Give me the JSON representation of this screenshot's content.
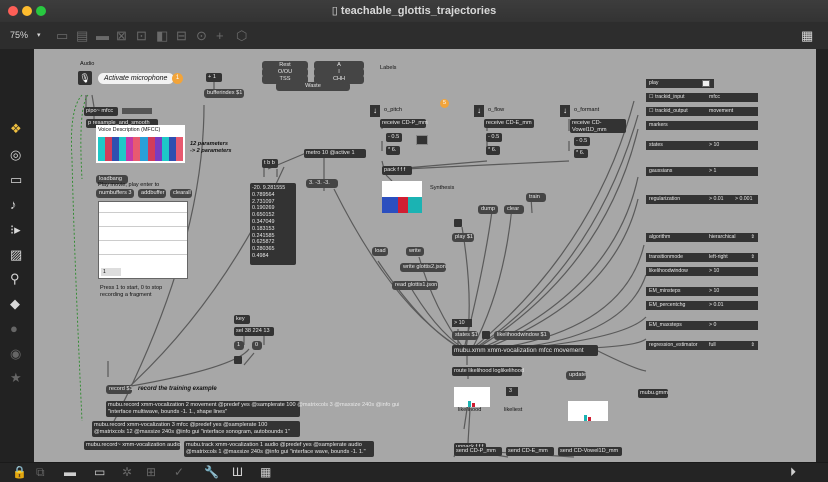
{
  "window": {
    "title": "teachable_glottis_trajectories",
    "zoom": "75%"
  },
  "toolbar": {
    "icons": [
      "presentation-icon",
      "comment-icon",
      "message-icon",
      "button-icon",
      "toggle-icon",
      "slider-icon",
      "dial-icon",
      "new-object-icon",
      "patch-cord-icon"
    ],
    "right_icon": "grid-icon"
  },
  "leftbar": {
    "icons": [
      "objects-icon",
      "target-icon",
      "screen-icon",
      "music-note-icon",
      "jitter-icon",
      "image-icon",
      "link-icon",
      "plugin-icon",
      "circle-icon",
      "sync-icon",
      "star-icon"
    ]
  },
  "bottombar": {
    "icons": [
      "lock-icon",
      "edit-icon",
      "presentation-icon",
      "window-icon",
      "debug-icon",
      "grid-icon",
      "check-icon",
      "wrench-icon",
      "vertical-bars-icon",
      "keyboard-icon",
      "play-icon"
    ]
  },
  "patch": {
    "audio_label": "Audio",
    "mic_label": "Activate microphone",
    "badge_1": "1",
    "pipo_mfcc": "pipo~ mfcc",
    "resample": "p resample_and_smooth",
    "voice_label": "Voice Description (MFCC)",
    "params_note_1": "12 parameters",
    "params_note_2": "-> 2 parameters",
    "loadbang": "loadbang",
    "play_hint": "Play movie, play enter to",
    "numbuffers": "numbuffers 3",
    "addbuffer": "addbuffer",
    "clearall": "clearall",
    "buffer_sel": "1",
    "press_hint_1": "Press 1 to start, 0 to stop",
    "press_hint_2": "recording a fragment",
    "plus1": "+ 1",
    "bufferindex": "bufferindex $1",
    "labels_title": "Labels",
    "labels": [
      "Rest",
      "A",
      "O/OU",
      "I",
      "TSS",
      "CHH",
      "Waste"
    ],
    "tbb": "t b b",
    "metro": "metro 10 @active 1",
    "values_list": [
      "-20. 9.281555",
      "0.789564",
      "2.731097",
      "0.190269",
      "0.650152",
      "0.347049",
      "0.183153",
      "0.241585",
      "0.625872",
      "0.280365",
      "0.4984"
    ],
    "msg_neg3": "3. -3. -3.",
    "key": "key",
    "sel": "sel 38 224 13",
    "num_1": "1",
    "num_0": "0",
    "record": "record $1",
    "record_comment": "record the training example",
    "mubu_record_1": "mubu.record xmm-vocalization 2 movement @predef yes @samplerate 100 @matrixcols 3 @maxsize 240s @info gui",
    "mubu_record_1b": "\"interface multiwave, bounds -1. 1., shape lines\"",
    "mubu_record_2": "mubu.record xmm-vocalization 3 mfcc @predef yes @samplerate 100",
    "mubu_record_2b": "@matrixcols 12 @maxsize 240s @info gui \"interface sonogram, autobounds 1\"",
    "mubu_record_3": "mubu.record~ xmm-vocalization audio",
    "mubu_track": "mubu.track xmm-vocalization 1 audio @predef yes @samplerate audio",
    "mubu_track_b": "@matrixcols 1 @maxsize 240s @info gui \"interface wave, bounds -1. 1.\"",
    "o_pitch": "o_pitch",
    "o_flow": "o_flow",
    "o_formant": "o_formant",
    "receive_p": "receive CD-P_mm",
    "receive_e": "receive CD-E_mm",
    "receive_v": "receive CD-Vowel1D_mm",
    "minus05": "- 0.5",
    "times6": "* 6.",
    "pack": "pack f f f",
    "synthesis": "Synthesis",
    "badge_5": "5",
    "dump": "dump",
    "clear": "clear",
    "train": "train",
    "play_msg": "play $1",
    "load": "load",
    "write": "write",
    "write_file": "write glottis2.json",
    "read_file": "read glottis1.json",
    "n10": "> 10",
    "states": "states $1",
    "likelihoodwindow": "likelihoodwindow $1",
    "mubu_xmm": "mubu.xmm xmm-vocalization mfcc movement",
    "route": "route likelihood loglikelihood",
    "update": "update",
    "n3": "3",
    "likelihood": "likelihood",
    "likeliest": "likeliest",
    "unpack": "unpack f f f",
    "send_p": "send CD-P_mm",
    "send_e": "send CD-E_mm",
    "send_v": "send CD-Vowel1D_mm",
    "mubu_gmm": "mubu.gmm"
  },
  "attributes": [
    {
      "name": "play",
      "value": "",
      "kind": "check"
    },
    {
      "name": "trackid_input",
      "value": "mfcc",
      "kind": "text"
    },
    {
      "name": "trackid_output",
      "value": "movement",
      "kind": "text"
    },
    {
      "name": "markers",
      "value": "",
      "kind": "text"
    },
    {
      "name": "states",
      "value": "> 10",
      "kind": "text"
    },
    {
      "name": "gaussians",
      "value": "> 1",
      "kind": "text"
    },
    {
      "name": "regularization",
      "value": "> 0.01",
      "value2": "> 0.001",
      "kind": "pair"
    },
    {
      "name": "algorithm",
      "value": "hierarchical",
      "kind": "menu"
    },
    {
      "name": "transitionmode",
      "value": "left-right",
      "kind": "menu"
    },
    {
      "name": "likelihoodwindow",
      "value": "> 10",
      "kind": "text"
    },
    {
      "name": "EM_minsteps",
      "value": "> 10",
      "kind": "text"
    },
    {
      "name": "EM_percentchg",
      "value": "> 0.01",
      "kind": "text"
    },
    {
      "name": "EM_maxsteps",
      "value": "> 0",
      "kind": "text"
    },
    {
      "name": "regression_estimator",
      "value": "full",
      "kind": "menu"
    }
  ],
  "colors": {
    "canvas": "#a7a7a7",
    "object": "#333333",
    "accent": "#f2a43a",
    "selection": "#2f6fd8"
  }
}
